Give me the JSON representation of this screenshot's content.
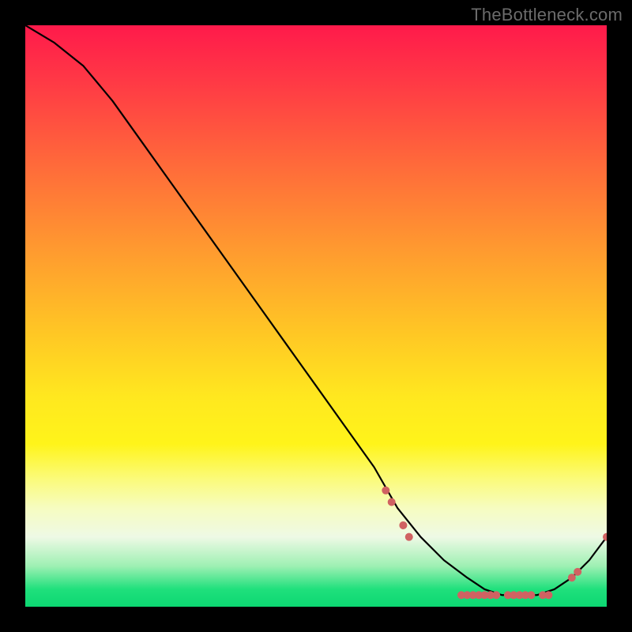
{
  "watermark": "TheBottleneck.com",
  "chart_data": {
    "type": "line",
    "title": "",
    "xlabel": "",
    "ylabel": "",
    "xlim": [
      0,
      100
    ],
    "ylim": [
      0,
      100
    ],
    "grid": false,
    "legend": false,
    "series": [
      {
        "name": "bottleneck-curve",
        "x": [
          0,
          5,
          10,
          15,
          20,
          25,
          30,
          35,
          40,
          45,
          50,
          55,
          60,
          64,
          68,
          72,
          76,
          79,
          82,
          85,
          88,
          91,
          94,
          97,
          100
        ],
        "y": [
          100,
          97,
          93,
          87,
          80,
          73,
          66,
          59,
          52,
          45,
          38,
          31,
          24,
          17,
          12,
          8,
          5,
          3,
          2,
          2,
          2,
          3,
          5,
          8,
          12
        ]
      }
    ],
    "markers": [
      {
        "x": 62,
        "y": 20
      },
      {
        "x": 63,
        "y": 18
      },
      {
        "x": 65,
        "y": 14
      },
      {
        "x": 66,
        "y": 12
      },
      {
        "x": 75,
        "y": 2
      },
      {
        "x": 76,
        "y": 2
      },
      {
        "x": 77,
        "y": 2
      },
      {
        "x": 78,
        "y": 2
      },
      {
        "x": 79,
        "y": 2
      },
      {
        "x": 80,
        "y": 2
      },
      {
        "x": 81,
        "y": 2
      },
      {
        "x": 83,
        "y": 2
      },
      {
        "x": 84,
        "y": 2
      },
      {
        "x": 85,
        "y": 2
      },
      {
        "x": 86,
        "y": 2
      },
      {
        "x": 87,
        "y": 2
      },
      {
        "x": 89,
        "y": 2
      },
      {
        "x": 90,
        "y": 2
      },
      {
        "x": 94,
        "y": 5
      },
      {
        "x": 95,
        "y": 6
      },
      {
        "x": 100,
        "y": 12
      }
    ],
    "colors": {
      "line": "#000000",
      "marker": "#d06262",
      "gradient_top": "#ff1a4b",
      "gradient_bottom": "#0cd772"
    }
  }
}
